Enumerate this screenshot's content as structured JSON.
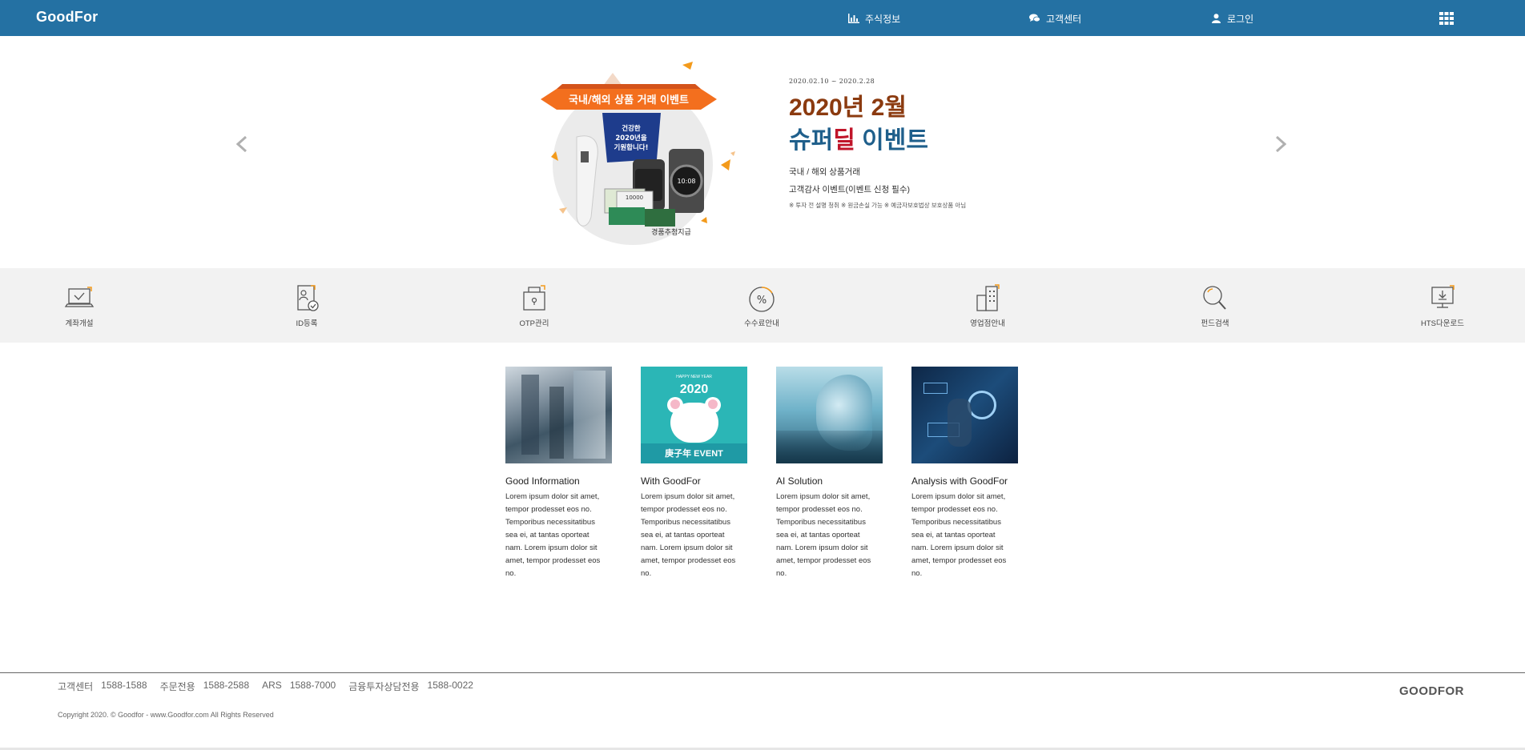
{
  "header": {
    "logo": "GoodFor",
    "nav": [
      {
        "label": "주식정보",
        "icon": "bar-chart-icon"
      },
      {
        "label": "고객센터",
        "icon": "chat-bubbles-icon"
      },
      {
        "label": "로그인",
        "icon": "user-icon"
      }
    ],
    "menu_icon": "grid-menu-icon",
    "background": "#2471a3"
  },
  "hero": {
    "date_range": "2020.02.10 ~ 2020.2.28",
    "title_line1": "2020년 2월",
    "title_line2_a": "슈퍼",
    "title_line2_b": "딜",
    "title_line2_c": " 이벤트",
    "sub1": "국내 / 해외 상품거래",
    "sub2": "고객감사 이벤트(이벤트 신청 필수)",
    "note": "※ 투자 전 설명 청취 ※ 원금손실 가능 ※ 예금자보호법상 보호상품 아님",
    "banner_ribbon": "국내/해외 상품 거래 이벤트",
    "banner_flag": [
      "건강한",
      "2020년을",
      "기원합니다!"
    ],
    "banner_watch_time": "10:08",
    "banner_bill": "10000",
    "banner_tag": "경품추첨지급",
    "colors": {
      "title1": "#8b3a0f",
      "title2": "#1f5f8b",
      "accent": "#c0152a"
    }
  },
  "quick_menu": [
    {
      "label": "계좌개설",
      "icon": "laptop-check-icon"
    },
    {
      "label": "ID등록",
      "icon": "id-document-icon"
    },
    {
      "label": "OTP관리",
      "icon": "otp-lock-icon"
    },
    {
      "label": "수수료안내",
      "icon": "percent-circle-icon"
    },
    {
      "label": "영업점안내",
      "icon": "building-icon"
    },
    {
      "label": "펀드검색",
      "icon": "magnifier-icon"
    },
    {
      "label": "HTS다운로드",
      "icon": "monitor-download-icon"
    }
  ],
  "cards": [
    {
      "title": "Good Information",
      "desc": "Lorem ipsum dolor sit amet, tempor prodesset eos no. Temporibus necessitatibus sea ei, at tantas oporteat nam. Lorem ipsum dolor sit amet, tempor prodesset eos no."
    },
    {
      "title": "With GoodFor",
      "desc": "Lorem ipsum dolor sit amet, tempor prodesset eos no. Temporibus necessitatibus sea ei, at tantas oporteat nam. Lorem ipsum dolor sit amet, tempor prodesset eos no.",
      "img_top": "HAPPY NEW YEAR",
      "img_year": "2020",
      "img_event": "庚子年 EVENT"
    },
    {
      "title": "AI Solution",
      "desc": "Lorem ipsum dolor sit amet, tempor prodesset eos no. Temporibus necessitatibus sea ei, at tantas oporteat nam. Lorem ipsum dolor sit amet, tempor prodesset eos no."
    },
    {
      "title": "Analysis with GoodFor",
      "desc": "Lorem ipsum dolor sit amet, tempor prodesset eos no. Temporibus necessitatibus sea ei, at tantas oporteat nam. Lorem ipsum dolor sit amet, tempor prodesset eos no."
    }
  ],
  "footer": {
    "contacts": [
      {
        "label": "고객센터",
        "number": "1588-1588"
      },
      {
        "label": "주문전용",
        "number": "1588-2588"
      },
      {
        "label": "ARS",
        "number": "1588-7000"
      },
      {
        "label": "금융투자상담전용",
        "number": "1588-0022"
      }
    ],
    "copyright": "Copyright 2020. © Goodfor - www.Goodfor.com All Rights Reserved",
    "logo": "GOODFOR"
  }
}
